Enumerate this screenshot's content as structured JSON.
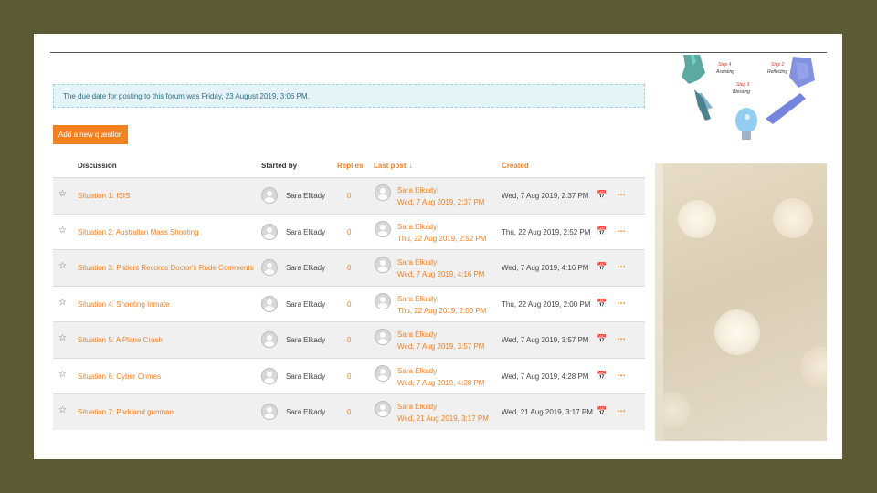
{
  "notice": "The due date for posting to this forum was Friday, 23 August 2019, 3:06 PM.",
  "add_button": "Add a new question",
  "columns": {
    "discussion": "Discussion",
    "started_by": "Started by",
    "replies": "Replies",
    "last_post": "Last post",
    "last_post_sort_icon": "down-arrow",
    "created": "Created"
  },
  "rows": [
    {
      "subject": "Situation 1: ISIS",
      "starter": "Sara Elkady",
      "replies": "0",
      "last_post_author": "Sara Elkady",
      "last_post_date": "Wed, 7 Aug 2019, 2:37 PM",
      "created": "Wed, 7 Aug 2019, 2:37 PM"
    },
    {
      "subject": "Situation 2: Australian Mass Shooting",
      "starter": "Sara Elkady",
      "replies": "0",
      "last_post_author": "Sara Elkady",
      "last_post_date": "Thu, 22 Aug 2019, 2:52 PM",
      "created": "Thu, 22 Aug 2019, 2:52 PM"
    },
    {
      "subject": "Situation 3: Patient Records Doctor's Rude Comments",
      "starter": "Sara Elkady",
      "replies": "0",
      "last_post_author": "Sara Elkady",
      "last_post_date": "Wed, 7 Aug 2019, 4:16 PM",
      "created": "Wed, 7 Aug 2019, 4:16 PM"
    },
    {
      "subject": "Situation 4: Shooting Inmate",
      "starter": "Sara Elkady",
      "replies": "0",
      "last_post_author": "Sara Elkady",
      "last_post_date": "Thu, 22 Aug 2019, 2:00 PM",
      "created": "Thu, 22 Aug 2019, 2:00 PM"
    },
    {
      "subject": "Situation 5: A Plane Crash",
      "starter": "Sara Elkady",
      "replies": "0",
      "last_post_author": "Sara Elkady",
      "last_post_date": "Wed, 7 Aug 2019, 3:57 PM",
      "created": "Wed, 7 Aug 2019, 3:57 PM"
    },
    {
      "subject": "Situation 6: Cyber Crimes",
      "starter": "Sara Elkady",
      "replies": "0",
      "last_post_author": "Sara Elkady",
      "last_post_date": "Wed, 7 Aug 2019, 4:28 PM",
      "created": "Wed, 7 Aug 2019, 4:28 PM"
    },
    {
      "subject": "Situation 7: Parkland gunman",
      "starter": "Sara Elkady",
      "replies": "0",
      "last_post_author": "Sara Elkady",
      "last_post_date": "Wed, 21 Aug 2019, 3:17 PM",
      "created": "Wed, 21 Aug 2019, 3:17 PM"
    }
  ],
  "row_icons": {
    "star": "star-outline-icon",
    "calendar": "calendar-icon",
    "more": "ellipsis-icon"
  },
  "diagram": {
    "step4": "Step 4",
    "step4_label": "Assisting",
    "step2": "Step 2",
    "step2_label": "Reflecting",
    "step3": "Step 3",
    "step3_label": "Blessing"
  },
  "colors": {
    "accent": "#f3811f",
    "frame": "#5b5a33",
    "notice_bg": "#e3f3f7",
    "row_alt": "#f0f0f0"
  }
}
